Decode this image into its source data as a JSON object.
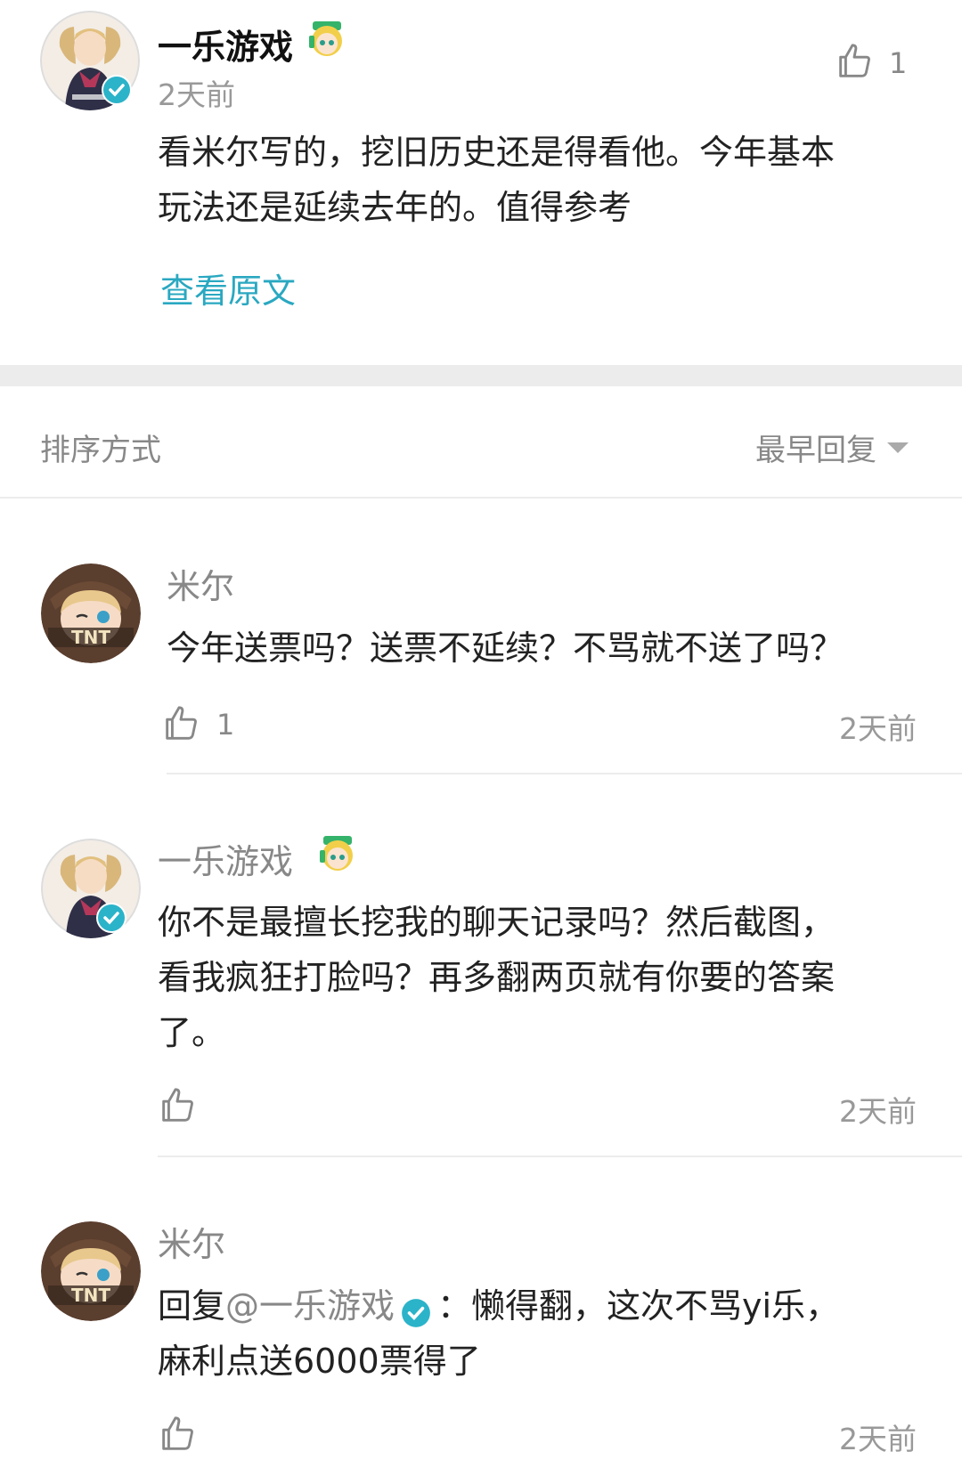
{
  "post": {
    "author": "一乐游戏",
    "time": "2天前",
    "like_count": "1",
    "text_line1": "看米尔写的，挖旧历史还是得看他。今年基本",
    "text_line2": "玩法还是延续去年的。值得参考",
    "view_original": "查看原文"
  },
  "sort": {
    "label": "排序方式",
    "value": "最早回复"
  },
  "comments": [
    {
      "author": "米尔",
      "text_line1": "今年送票吗？送票不延续？不骂就不送了吗？",
      "like_count": "1",
      "time": "2天前"
    },
    {
      "author": "一乐游戏",
      "text_line1": "你不是最擅长挖我的聊天记录吗？然后截图，",
      "text_line2": "看我疯狂打脸吗？再多翻两页就有你要的答案",
      "text_line3": "了。",
      "time": "2天前"
    },
    {
      "author": "米尔",
      "reply_prefix": "回复",
      "mention": "@一乐游戏",
      "text_line1_rest": "：懒得翻，这次不骂yi乐，",
      "text_line2": "麻利点送6000票得了",
      "time": "2天前"
    }
  ],
  "colors": {
    "link": "#2aa8c1",
    "verified": "#2bb3c9",
    "gray_text": "#888888",
    "divider": "#ececec"
  },
  "icons": [
    "thumbs-up-icon",
    "verified-badge-icon",
    "caret-down-icon",
    "mascot-emoji-icon"
  ]
}
